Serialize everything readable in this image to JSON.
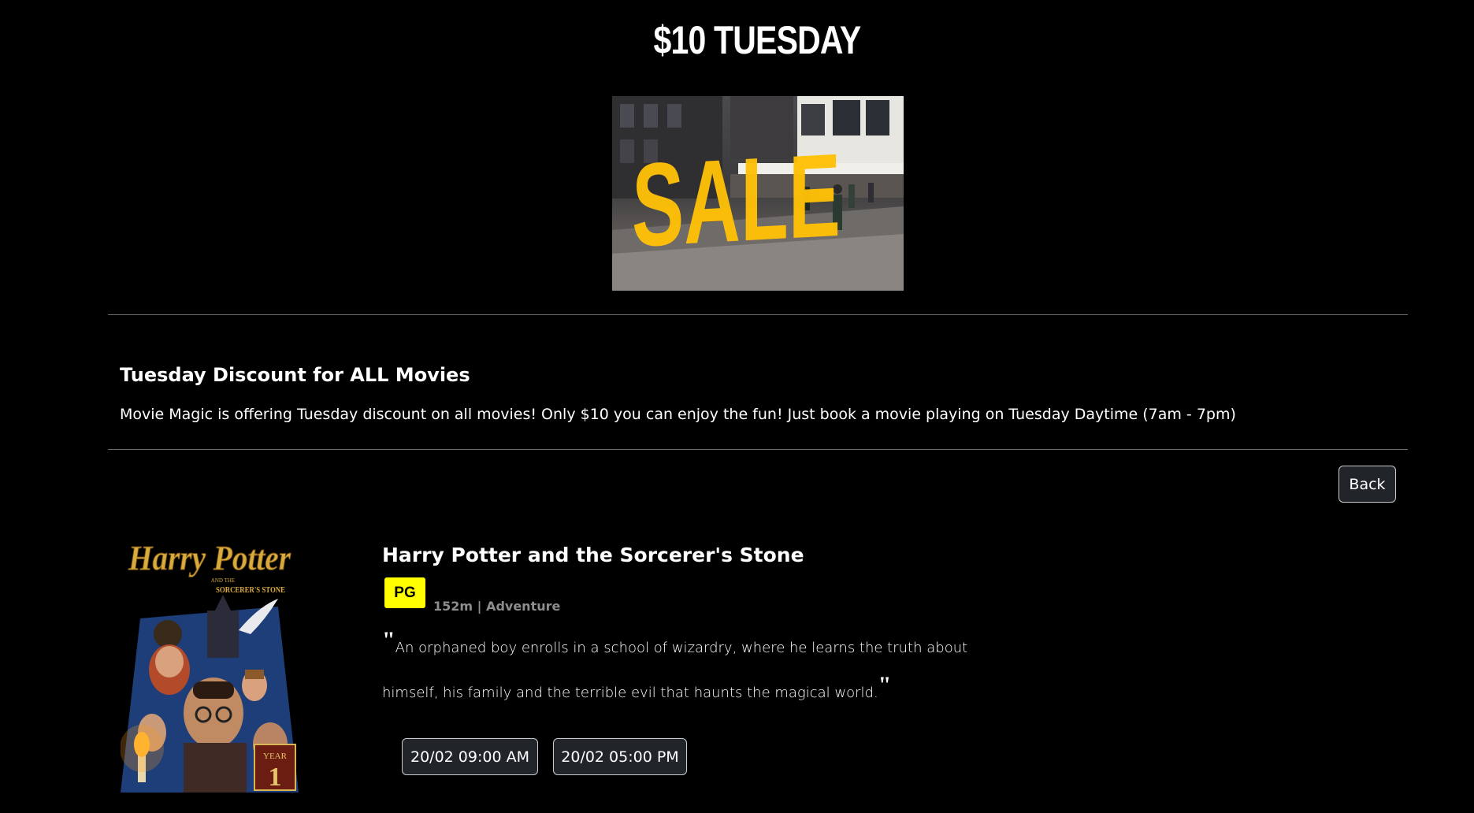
{
  "promo": {
    "title": "$10 TUESDAY",
    "banner_text": "SALE",
    "banner_color": "#ffc107"
  },
  "discount": {
    "heading": "Tuesday Discount for ALL Movies",
    "description": "Movie Magic is offering Tuesday discount on all movies! Only $10 you can enjoy the fun! Just book a movie playing on Tuesday Daytime (7am - 7pm)"
  },
  "actions": {
    "back_label": "Back"
  },
  "movie": {
    "poster": {
      "title_line1": "Harry Potter",
      "subtitle_and": "AND THE",
      "subtitle": "SORCERER'S STONE",
      "year_label": "YEAR",
      "year_number": "1"
    },
    "title": "Harry Potter and the Sorcerer's Stone",
    "rating": "PG",
    "rating_color": "#ffff00",
    "meta": "152m | Adventure",
    "open_quote": "\"",
    "close_quote": "\"",
    "synopsis": "An orphaned boy enrolls in a school of wizardry, where he learns the truth about himself, his family and the terrible evil that haunts the magical world.",
    "showtimes": [
      "20/02 09:00 AM",
      "20/02 05:00 PM"
    ]
  }
}
